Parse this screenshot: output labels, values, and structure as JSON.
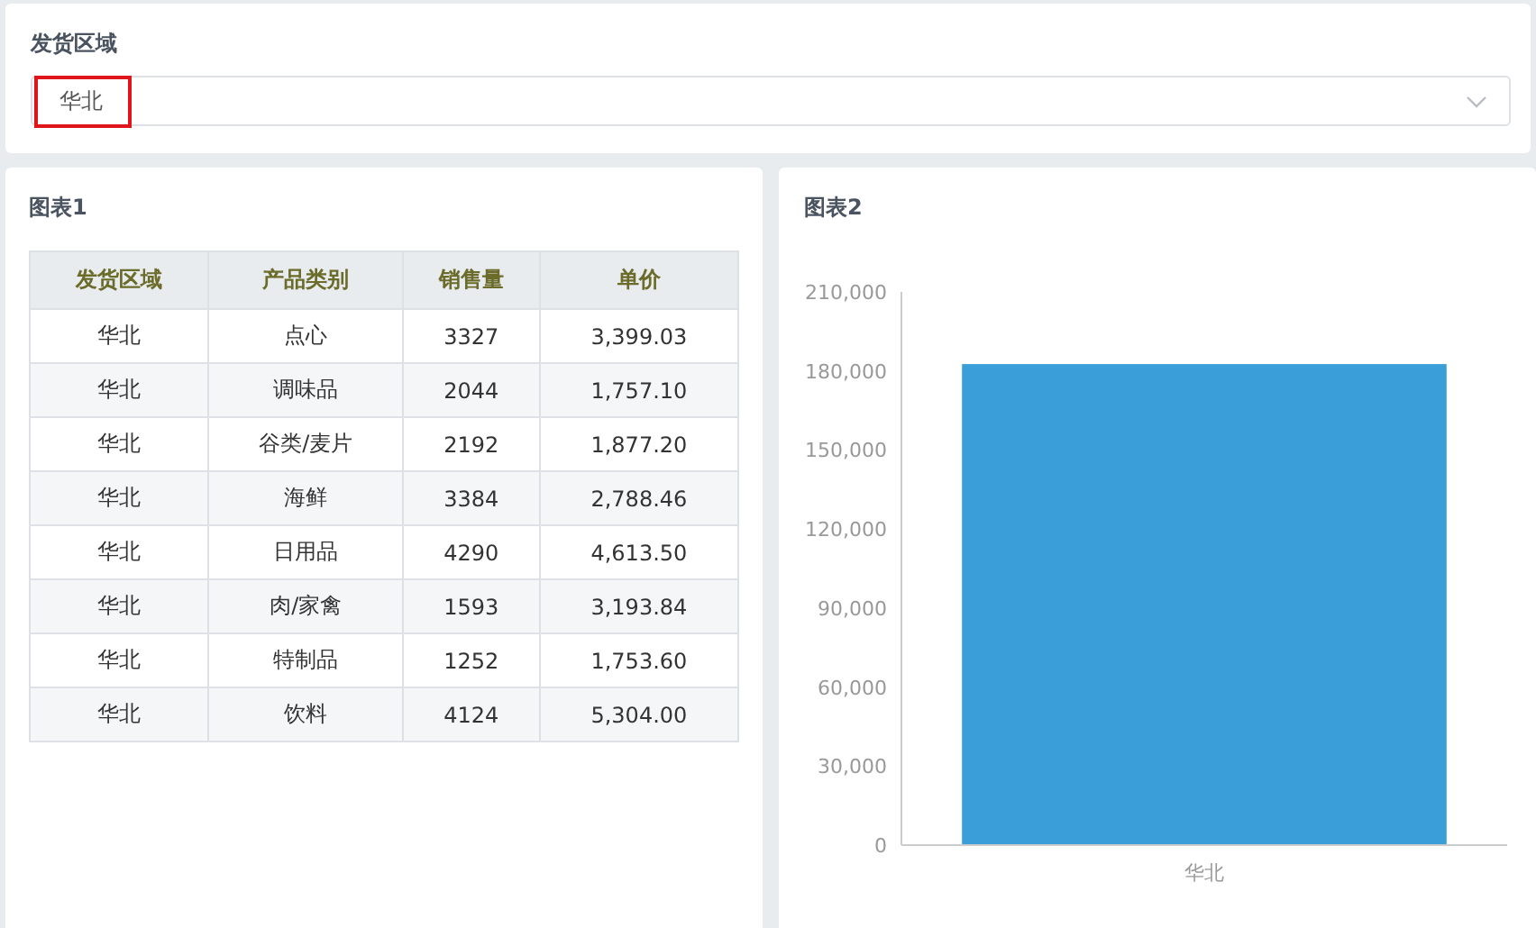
{
  "filter": {
    "label": "发货区域",
    "value": "华北",
    "highlighted": true
  },
  "table_card": {
    "title": "图表1",
    "columns": [
      "发货区域",
      "产品类别",
      "销售量",
      "单价"
    ],
    "rows": [
      [
        "华北",
        "点心",
        "3327",
        "3,399.03"
      ],
      [
        "华北",
        "调味品",
        "2044",
        "1,757.10"
      ],
      [
        "华北",
        "谷类/麦片",
        "2192",
        "1,877.20"
      ],
      [
        "华北",
        "海鲜",
        "3384",
        "2,788.46"
      ],
      [
        "华北",
        "日用品",
        "4290",
        "4,613.50"
      ],
      [
        "华北",
        "肉/家禽",
        "1593",
        "3,193.84"
      ],
      [
        "华北",
        "特制品",
        "1252",
        "1,753.60"
      ],
      [
        "华北",
        "饮料",
        "4124",
        "5,304.00"
      ]
    ]
  },
  "chart_card": {
    "title": "图表2",
    "chart_data": {
      "type": "bar",
      "categories": [
        "华北"
      ],
      "series": [
        {
          "color": "#3a9fd8",
          "values": [
            182600
          ]
        }
      ],
      "ylim": [
        0,
        210000
      ],
      "yticks": [
        {
          "value": 0,
          "label": "0"
        },
        {
          "value": 30000,
          "label": "30,000"
        },
        {
          "value": 60000,
          "label": "60,000"
        },
        {
          "value": 90000,
          "label": "90,000"
        },
        {
          "value": 120000,
          "label": "120,000"
        },
        {
          "value": 150000,
          "label": "150,000"
        },
        {
          "value": 180000,
          "label": "180,000"
        },
        {
          "value": 210000,
          "label": "210,000"
        }
      ]
    }
  }
}
